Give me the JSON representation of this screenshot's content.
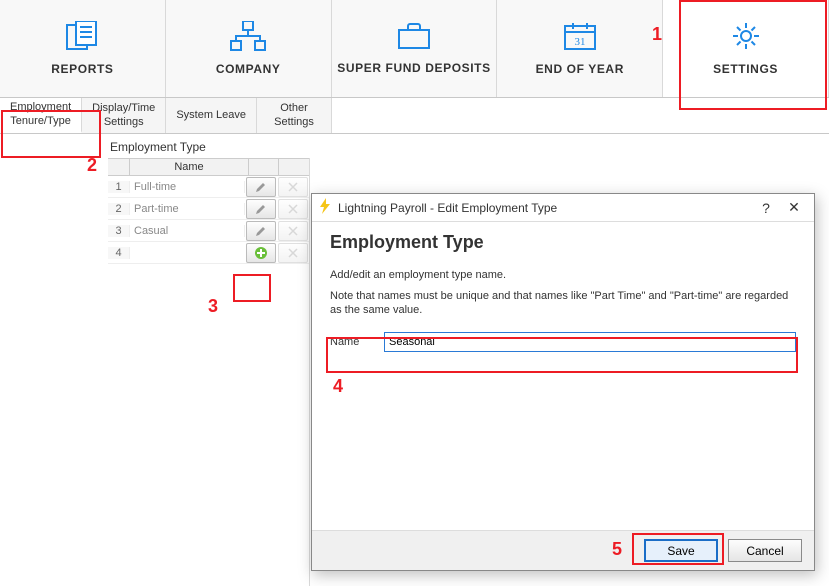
{
  "topnav": [
    {
      "label": "REPORTS",
      "icon": "reports"
    },
    {
      "label": "COMPANY",
      "icon": "company"
    },
    {
      "label": "SUPER FUND DEPOSITS",
      "icon": "superfund"
    },
    {
      "label": "END OF YEAR",
      "icon": "calendar"
    },
    {
      "label": "SETTINGS",
      "icon": "gear",
      "selected": true
    }
  ],
  "subtabs": [
    {
      "label": "Employment\nTenure/Type",
      "active": true
    },
    {
      "label": "Display/Time\nSettings"
    },
    {
      "label": "System Leave"
    },
    {
      "label": "Other\nSettings"
    }
  ],
  "page": {
    "title": "Employment Type"
  },
  "grid": {
    "header": "Name",
    "rows": [
      {
        "num": "1",
        "name": "Full-time"
      },
      {
        "num": "2",
        "name": "Part-time"
      },
      {
        "num": "3",
        "name": "Casual"
      },
      {
        "num": "4",
        "name": ""
      }
    ]
  },
  "dialog": {
    "title": "Lightning Payroll - Edit Employment Type",
    "heading": "Employment Type",
    "desc": "Add/edit an employment type name.",
    "note": "Note that names must be unique and that names like \"Part Time\" and \"Part-time\" are regarded as the same value.",
    "field_label": "Name",
    "field_value": "Seasonal",
    "save_label": "Save",
    "cancel_label": "Cancel",
    "help_glyph": "?",
    "close_glyph": "✕"
  },
  "annotations": {
    "n1": "1",
    "n2": "2",
    "n3": "3",
    "n4": "4",
    "n5": "5"
  }
}
